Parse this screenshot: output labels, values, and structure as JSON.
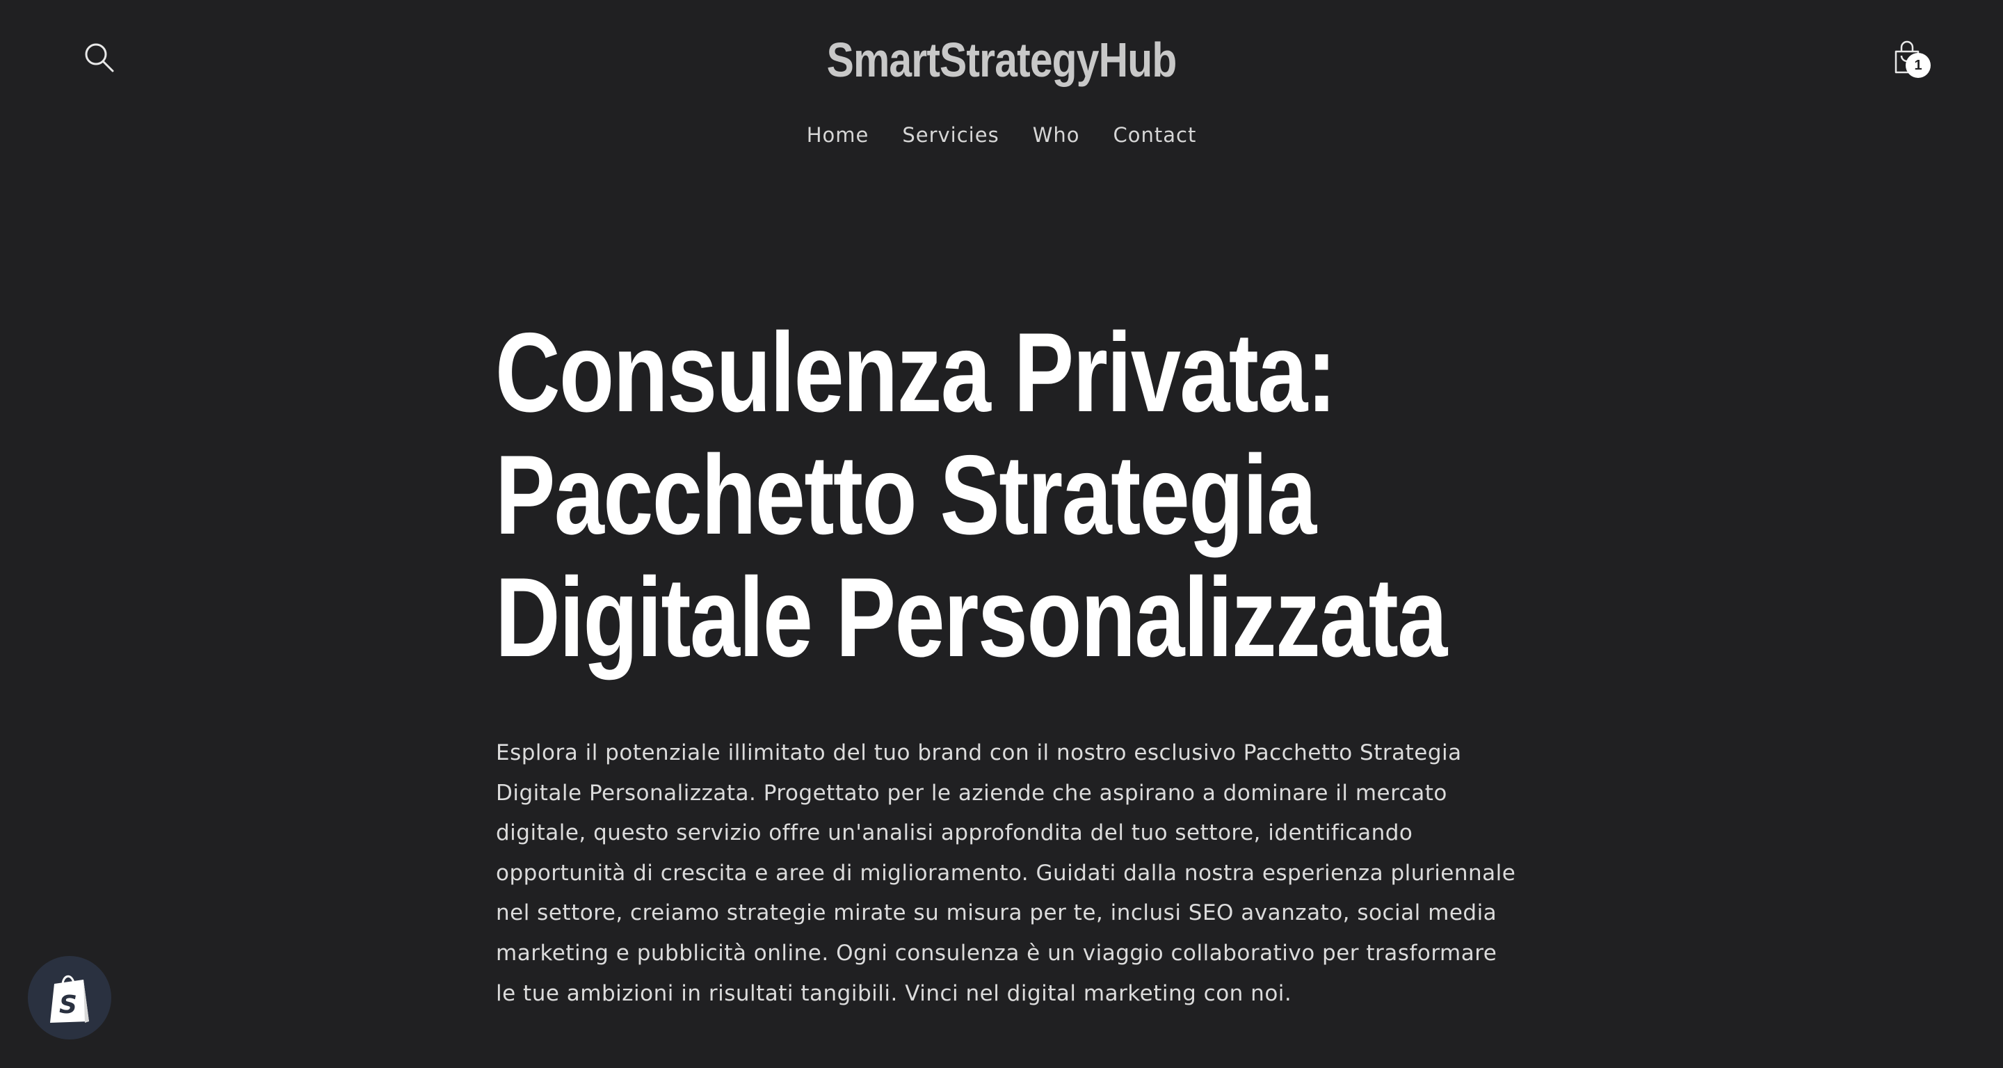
{
  "header": {
    "brand": "SmartStrategyHub",
    "search_icon": "search-icon",
    "cart_icon": "shopping-bag-icon",
    "cart_count": "1"
  },
  "nav": {
    "items": [
      {
        "label": "Home"
      },
      {
        "label": "Servicies"
      },
      {
        "label": "Who"
      },
      {
        "label": "Contact"
      }
    ]
  },
  "hero": {
    "title_lines": [
      "Consulenza Privata:",
      "Pacchetto Strategia",
      "Digitale Personalizzata"
    ],
    "description": "Esplora il potenziale illimitato del tuo brand con il nostro esclusivo Pacchetto Strategia Digitale Personalizzata. Progettato per le aziende che aspirano a dominare il mercato digitale, questo servizio offre un'analisi approfondita del tuo settore, identificando opportunità di crescita e aree di miglioramento. Guidati dalla nostra esperienza pluriennale nel settore, creiamo strategie mirate su misura per te, inclusi SEO avanzato, social media marketing e pubblicità online. Ogni consulenza è un viaggio collaborativo per trasformare le tue ambizioni in risultati tangibili. Vinci nel digital marketing con noi."
  },
  "shopify_badge": {
    "icon": "shopify-bag-icon"
  },
  "colors": {
    "background": "#202022",
    "brand_text": "#c8c8c8",
    "nav_text": "#d6d6d6",
    "title_text": "#ffffff",
    "body_text": "#dcdcdc",
    "badge_bg": "#2a3140",
    "shopify_green": "#95bf47"
  }
}
